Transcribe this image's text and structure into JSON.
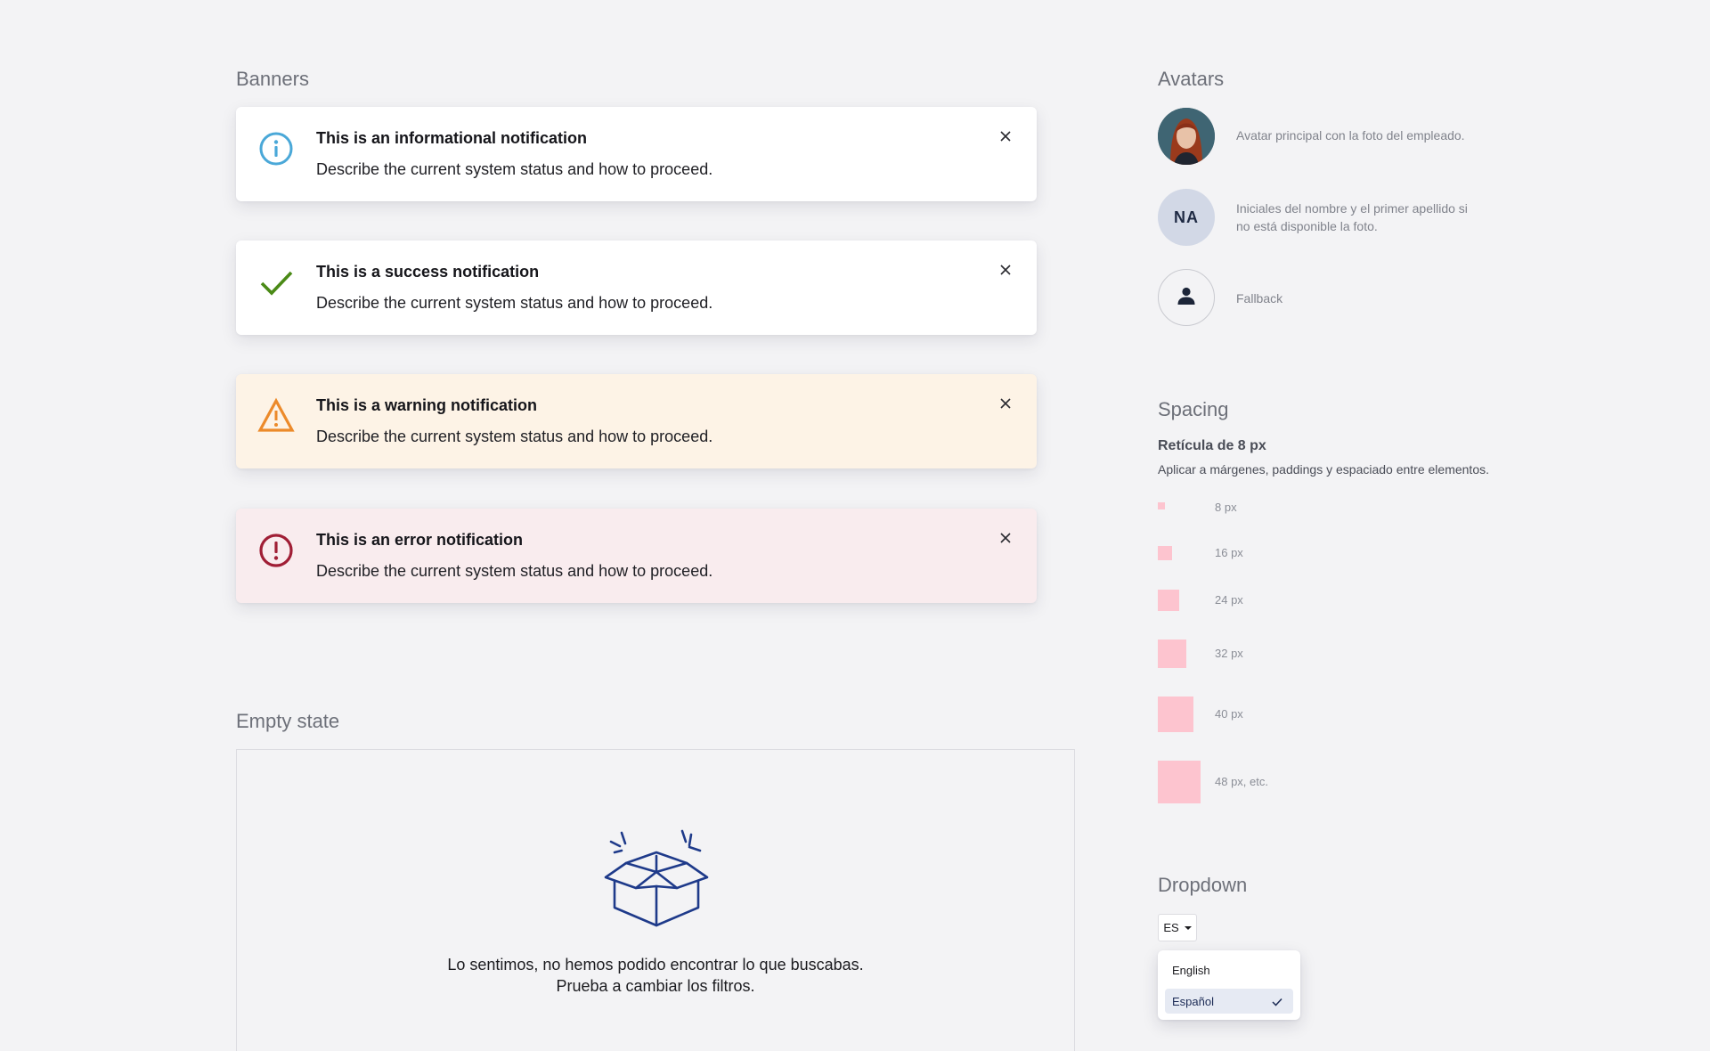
{
  "banners": {
    "section_title": "Banners",
    "close_symbol": "×",
    "items": [
      {
        "type": "info",
        "icon": "info-circle-icon",
        "color": "#4aa8d8",
        "title": "This is an informational notification",
        "description": "Describe the current system status and how to proceed."
      },
      {
        "type": "success",
        "icon": "check-icon",
        "color": "#4a8a16",
        "title": "This is a success notification",
        "description": "Describe the current system status and how to proceed."
      },
      {
        "type": "warning",
        "icon": "warning-triangle-icon",
        "color": "#ec8a2a",
        "title": "This is a warning notification",
        "description": "Describe the current system status and how to proceed."
      },
      {
        "type": "error",
        "icon": "error-circle-icon",
        "color": "#a01e35",
        "title": "This is an error notification",
        "description": "Describe the current system status and how to proceed."
      }
    ]
  },
  "empty_state": {
    "section_title": "Empty state",
    "icon": "open-box-icon",
    "color": "#1e3a8a",
    "line1": "Lo sentimos, no hemos podido encontrar lo que buscabas.",
    "line2": "Prueba a cambiar los filtros."
  },
  "avatars": {
    "section_title": "Avatars",
    "photo": {
      "description": "Avatar principal con la foto del empleado."
    },
    "initials": {
      "text": "NA",
      "description": "Iniciales del nombre y el primer apellido si no está disponible la foto."
    },
    "fallback": {
      "icon": "person-icon",
      "description": "Fallback"
    }
  },
  "spacing": {
    "section_title": "Spacing",
    "heading": "Retícula de 8 px",
    "subtitle": "Aplicar a márgenes, paddings y espaciado entre elementos.",
    "swatch_color": "#fdc4cf",
    "labels": [
      "8 px",
      "16 px",
      "24 px",
      "32 px",
      "40 px",
      "48 px, etc."
    ]
  },
  "dropdown": {
    "section_title": "Dropdown",
    "selected_value": "ES",
    "options": [
      {
        "label": "English",
        "selected": false
      },
      {
        "label": "Español",
        "selected": true
      }
    ]
  }
}
